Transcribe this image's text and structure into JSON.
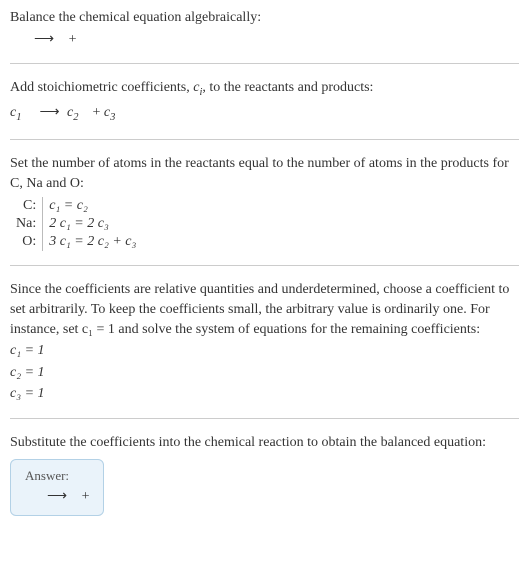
{
  "intro": {
    "line1": "Balance the chemical equation algebraically:",
    "line2_prefix": "",
    "arrow": "⟶",
    "plus": "+"
  },
  "stoich": {
    "line1": "Add stoichiometric coefficients, ",
    "ci": "c",
    "ci_sub": "i",
    "line1b": ", to the reactants and products:",
    "c1": "c",
    "c1_sub": "1",
    "c2": "c",
    "c2_sub": "2",
    "c3": "c",
    "c3_sub": "3"
  },
  "atoms": {
    "line1": "Set the number of atoms in the reactants equal to the number of atoms in the products for C, Na and O:",
    "rows": [
      {
        "label": "C:",
        "eq": "c₁ = c₂"
      },
      {
        "label": "Na:",
        "eq": "2 c₁ = 2 c₃"
      },
      {
        "label": "O:",
        "eq": "3 c₁ = 2 c₂ + c₃"
      }
    ]
  },
  "choose": {
    "para": "Since the coefficients are relative quantities and underdetermined, choose a coefficient to set arbitrarily. To keep the coefficients small, the arbitrary value is ordinarily one. For instance, set c₁ = 1 and solve the system of equations for the remaining coefficients:",
    "sol": [
      "c₁ = 1",
      "c₂ = 1",
      "c₃ = 1"
    ]
  },
  "subst": {
    "line": "Substitute the coefficients into the chemical reaction to obtain the balanced equation:"
  },
  "answer": {
    "label": "Answer:",
    "arrow": "⟶",
    "plus": "+"
  }
}
